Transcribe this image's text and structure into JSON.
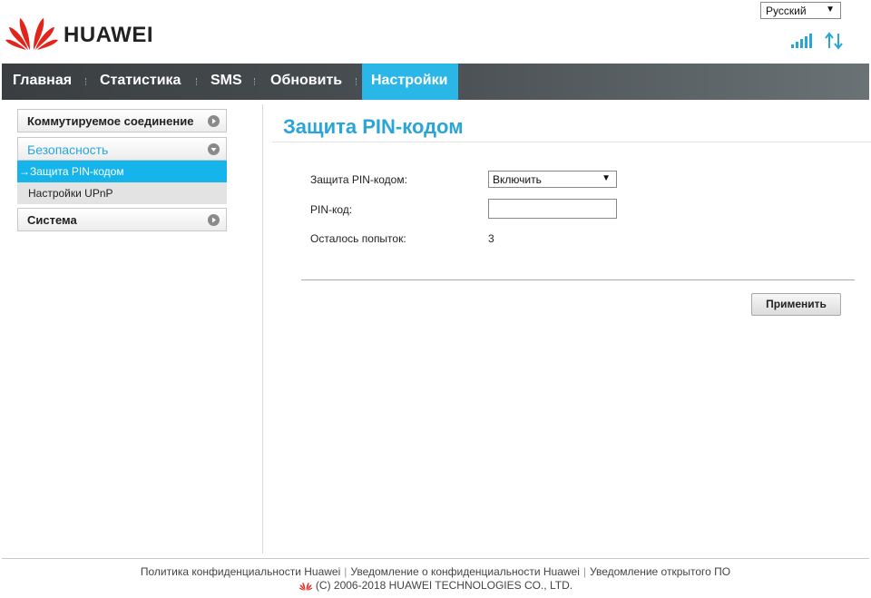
{
  "header": {
    "brand": "HUAWEI",
    "language": "Русский"
  },
  "nav": {
    "items": [
      "Главная",
      "Статистика",
      "SMS",
      "Обновить",
      "Настройки"
    ],
    "active": "Настройки"
  },
  "sidebar": {
    "groups": [
      {
        "label": "Коммутируемое соединение"
      },
      {
        "label": "Безопасность",
        "items": [
          "→Защита PIN-кодом",
          "Настройки UPnP"
        ]
      },
      {
        "label": "Система"
      }
    ]
  },
  "main": {
    "title": "Защита PIN-кодом",
    "fields": {
      "pin_protection_label": "Защита PIN-кодом:",
      "pin_protection_value": "Включить",
      "pin_code_label": "PIN-код:",
      "pin_code_value": "",
      "attempts_label": "Осталось попыток:",
      "attempts_value": "3"
    },
    "apply_label": "Применить"
  },
  "footer": {
    "links": [
      "Политика конфиденциальности Huawei",
      "Уведомление о конфиденциальности Huawei",
      "Уведомление открытого ПО"
    ],
    "copyright": "(C) 2006-2018 HUAWEI TECHNOLOGIES CO., LTD."
  },
  "colors": {
    "accent": "#2bb6e8",
    "brand_red": "#e1251b",
    "navbar": "#3a3e41"
  }
}
